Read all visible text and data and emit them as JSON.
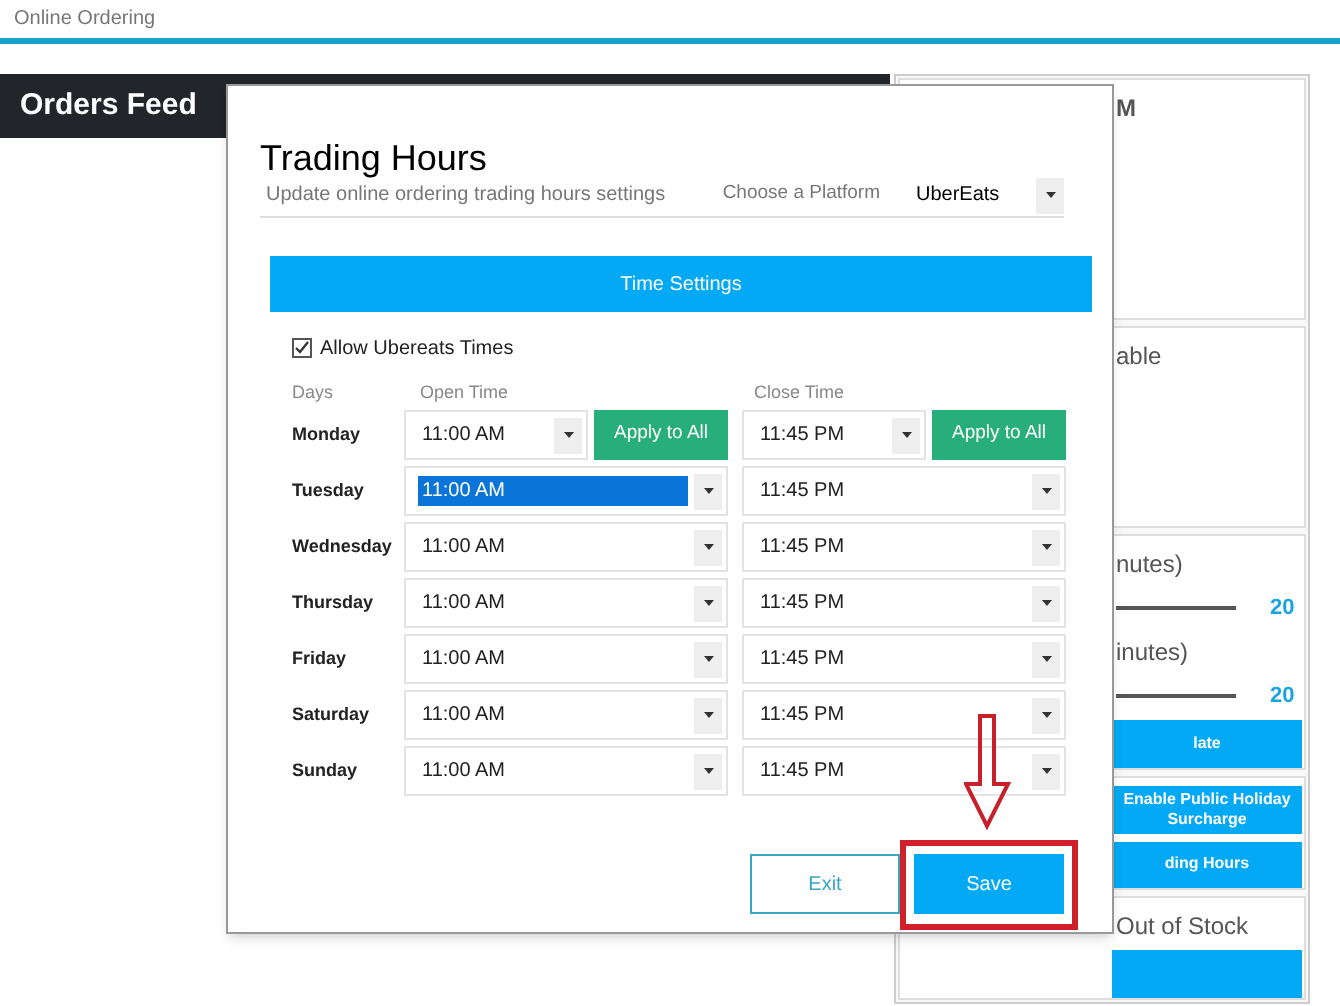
{
  "app": {
    "title": "Online Ordering"
  },
  "orders_feed": {
    "title": "Orders Feed"
  },
  "side_panel": [
    {
      "items": [
        {
          "kind": "label",
          "text": "M"
        }
      ]
    },
    {
      "items": [
        {
          "kind": "label",
          "text": "able"
        }
      ]
    },
    {
      "items": [
        {
          "kind": "label",
          "text": "nutes)"
        },
        {
          "kind": "slider",
          "reading": "20"
        },
        {
          "kind": "label",
          "text": "inutes)"
        },
        {
          "kind": "slider",
          "reading": "20"
        },
        {
          "kind": "button",
          "text": "late"
        }
      ]
    },
    {
      "items": [
        {
          "kind": "button",
          "text": "Enable Public Holiday Surcharge"
        },
        {
          "kind": "button",
          "text": "ding Hours"
        }
      ]
    },
    {
      "items": [
        {
          "kind": "label",
          "text": "Out of Stock"
        },
        {
          "kind": "button"
        }
      ]
    }
  ],
  "dialog": {
    "title": "Trading Hours",
    "subtitle": "Update online ordering trading hours settings",
    "platform": {
      "label": "Choose a Platform",
      "value": "UberEats"
    },
    "section_bar": "Time Settings",
    "allow_times": {
      "label": "Allow Ubereats Times",
      "checked": true
    },
    "columns": [
      "Days",
      "Open Time",
      "Close Time"
    ],
    "days": [
      {
        "day": "Monday",
        "open": {
          "value": "11:00 AM",
          "highlighted": false,
          "button": "Apply to All"
        },
        "close": {
          "value": "11:45 PM",
          "highlighted": false,
          "button": "Apply to All"
        }
      },
      {
        "day": "Tuesday",
        "open": {
          "value": "11:00 AM",
          "highlighted": true
        },
        "close": {
          "value": "11:45 PM",
          "highlighted": false
        }
      },
      {
        "day": "Wednesday",
        "open": {
          "value": "11:00 AM",
          "highlighted": false
        },
        "close": {
          "value": "11:45 PM",
          "highlighted": false
        }
      },
      {
        "day": "Thursday",
        "open": {
          "value": "11:00 AM",
          "highlighted": false
        },
        "close": {
          "value": "11:45 PM",
          "highlighted": false
        }
      },
      {
        "day": "Friday",
        "open": {
          "value": "11:00 AM",
          "highlighted": false
        },
        "close": {
          "value": "11:45 PM",
          "highlighted": false
        }
      },
      {
        "day": "Saturday",
        "open": {
          "value": "11:00 AM",
          "highlighted": false
        },
        "close": {
          "value": "11:45 PM",
          "highlighted": false
        }
      },
      {
        "day": "Sunday",
        "open": {
          "value": "11:00 AM",
          "highlighted": false
        },
        "close": {
          "value": "11:45 PM",
          "highlighted": false
        }
      }
    ],
    "buttons": [
      {
        "kind": "outline",
        "label": "Exit",
        "highlighted": false
      },
      {
        "kind": "primary",
        "label": "Save",
        "highlighted": true
      }
    ]
  }
}
